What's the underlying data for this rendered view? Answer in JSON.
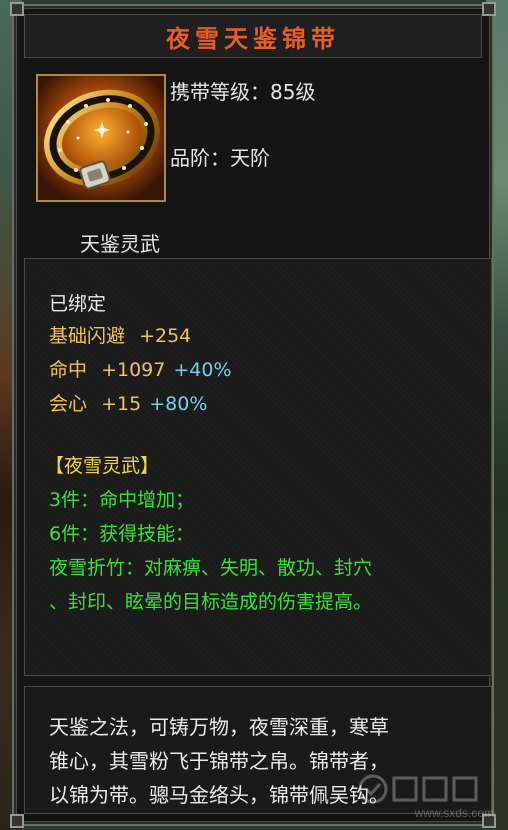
{
  "item": {
    "name": "夜雪天鉴锦带",
    "carry_level": "携带等级：85级",
    "grade": "品阶：天阶",
    "series": "天鉴灵武"
  },
  "attributes": {
    "bound": "已绑定",
    "dodge": {
      "label": "基础闪避",
      "value": "+254"
    },
    "hit": {
      "label": "命中",
      "value": "+1097",
      "bonus": "+40%"
    },
    "crit": {
      "label": "会心",
      "value": "+15",
      "bonus": "+80%"
    }
  },
  "set": {
    "name": "【夜雪灵武】",
    "piece3": "3件：命中增加；",
    "piece6": "6件：获得技能：",
    "skill_line1": "夜雪折竹：对麻痹、失明、散功、封穴",
    "skill_line2": "、封印、眩晕的目标造成的伤害提高。"
  },
  "description": {
    "line1": "天鉴之法，可铸万物，夜雪深重，寒草",
    "line2": "锥心，其雪粉飞于锦带之帛。锦带者，",
    "line3": "以锦为带。骢马金络头，锦带佩吴钩。"
  },
  "watermark": "www.sxds.com",
  "icon": "belt-icon"
}
